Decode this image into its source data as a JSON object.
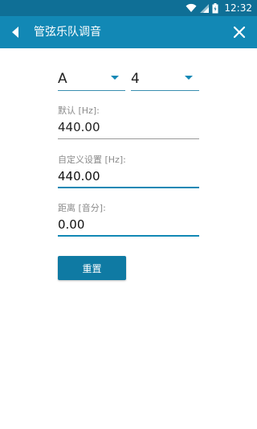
{
  "status_bar": {
    "time": "12:32",
    "icons": [
      "wifi-icon",
      "signal-icon",
      "battery-icon"
    ]
  },
  "app_bar": {
    "title": "管弦乐队调音",
    "back_icon": "back-triangle-icon",
    "close_icon": "close-icon"
  },
  "note_select": {
    "value": "A"
  },
  "octave_select": {
    "value": "4"
  },
  "default_freq": {
    "label": "默认 [Hz]:",
    "value": "440.00"
  },
  "custom_freq": {
    "label": "自定义设置 [Hz]:",
    "value": "440.00"
  },
  "distance": {
    "label": "距离 [音分]:",
    "value": "0.00"
  },
  "reset_button": {
    "label": "重置"
  },
  "colors": {
    "status_bar": "#0f6f96",
    "app_bar": "#1288b5",
    "accent": "#1288b5",
    "button": "#0f7aa3"
  }
}
